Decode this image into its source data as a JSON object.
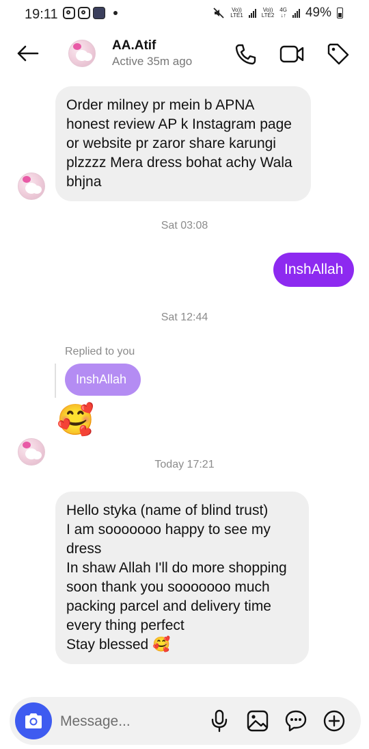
{
  "status_bar": {
    "time": "19:11",
    "sim1_label_top": "Vo))",
    "sim1_label_bottom": "LTE1",
    "sim2_label_top": "Vo))",
    "sim2_label_bottom": "LTE2",
    "network_type": "4G",
    "battery": "49%"
  },
  "header": {
    "contact_name": "AA.Atif",
    "contact_status": "Active 35m ago",
    "icons": [
      "back-arrow-icon",
      "phone-icon",
      "video-icon",
      "tag-icon"
    ]
  },
  "messages": {
    "m1": "Order milney pr mein b APNA honest review AP k Instagram page or website pr zaror share karungi plzzzz Mera dress bohat achy Wala bhjna",
    "ts1": "Sat 03:08",
    "m2": "InshAllah",
    "ts2": "Sat 12:44",
    "reply_label": "Replied to you",
    "reply_quote": "InshAllah",
    "reply_emoji": "🥰",
    "ts3": "Today 17:21",
    "m4_line1": "Hello styka (name of blind trust)",
    "m4_line2": "I am sooooooo happy to see my dress",
    "m4_line3": "In shaw Allah I'll do more shopping soon  thank you sooooooo much packing parcel and delivery time every thing perfect",
    "m4_line4": "Stay blessed 🥰"
  },
  "composer": {
    "placeholder": "Message...",
    "icons": [
      "camera-icon",
      "microphone-icon",
      "image-icon",
      "sticker-icon",
      "plus-icon"
    ]
  },
  "colors": {
    "outgoing_bubble": "#8d2af0",
    "reply_bubble": "#b48cf3",
    "incoming_bubble": "#efefef",
    "camera_button": "#3e5bf0"
  }
}
